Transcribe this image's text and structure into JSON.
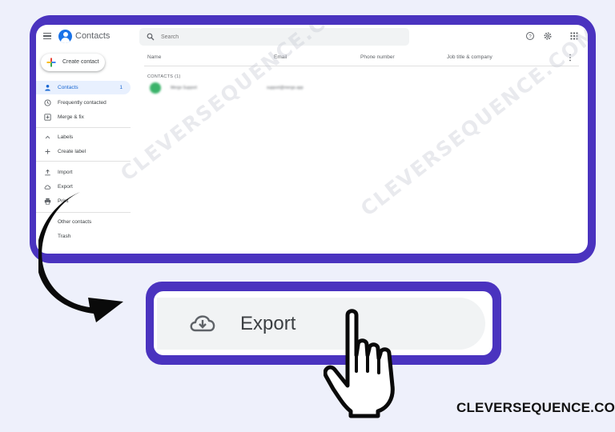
{
  "app": {
    "title": "Contacts"
  },
  "search": {
    "placeholder": "Search"
  },
  "sidebar": {
    "create_label": "Create contact",
    "items": [
      {
        "label": "Contacts",
        "count": "1"
      },
      {
        "label": "Frequently contacted"
      },
      {
        "label": "Merge & fix"
      },
      {
        "label": "Labels"
      },
      {
        "label": "Create label"
      },
      {
        "label": "Import"
      },
      {
        "label": "Export"
      },
      {
        "label": "Print"
      },
      {
        "label": "Other contacts"
      },
      {
        "label": "Trash"
      }
    ]
  },
  "table": {
    "columns": [
      "Name",
      "Email",
      "Phone number",
      "Job title & company"
    ],
    "section_label": "CONTACTS (1)",
    "rows": [
      {
        "name": "Mergo Support",
        "email": "support@mergo.app"
      }
    ]
  },
  "zoom": {
    "label": "Export"
  },
  "watermark": "CLEVERSEQUENCE.COM",
  "brand": "CLEVERSEQUENCE.COM",
  "colors": {
    "frame": "#4a33bf",
    "accent": "#1a73e8",
    "active_bg": "#e8f0fe"
  }
}
